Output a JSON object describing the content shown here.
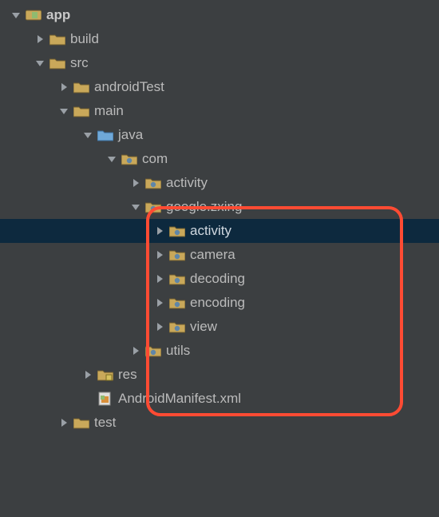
{
  "tree": {
    "app": "app",
    "build": "build",
    "src": "src",
    "androidTest": "androidTest",
    "main": "main",
    "java": "java",
    "com": "com",
    "activity_pkg": "activity",
    "google_zxing": "google.zxing",
    "zxing_activity": "activity",
    "zxing_camera": "camera",
    "zxing_decoding": "decoding",
    "zxing_encoding": "encoding",
    "zxing_view": "view",
    "utils": "utils",
    "res": "res",
    "manifest": "AndroidManifest.xml",
    "test": "test"
  }
}
